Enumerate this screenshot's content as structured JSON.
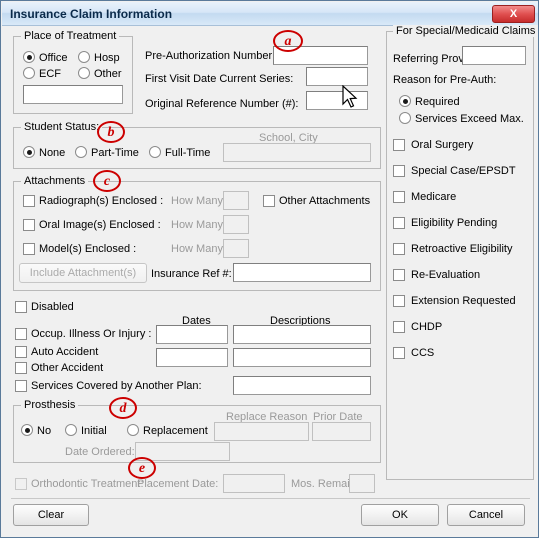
{
  "window": {
    "title": "Insurance Claim Information",
    "close_label": "X"
  },
  "place_of_treatment": {
    "legend": "Place of Treatment",
    "options": [
      {
        "label": "Office",
        "selected": true
      },
      {
        "label": "Hosp",
        "selected": false
      },
      {
        "label": "ECF",
        "selected": false
      },
      {
        "label": "Other",
        "selected": false
      }
    ],
    "other_value": ""
  },
  "preauth": {
    "number_label": "Pre-Authorization Number:",
    "number_value": "",
    "first_visit_label": "First Visit Date Current Series:",
    "first_visit_value": "",
    "orig_ref_label": "Original Reference Number (#):",
    "orig_ref_value": ""
  },
  "student_status": {
    "legend": "Student Status:",
    "options": [
      {
        "label": "None",
        "selected": true
      },
      {
        "label": "Part-Time",
        "selected": false
      },
      {
        "label": "Full-Time",
        "selected": false
      }
    ],
    "school_placeholder": "School, City",
    "school_value": ""
  },
  "attachments": {
    "legend": "Attachments",
    "rows": [
      {
        "label": "Radiograph(s) Enclosed :",
        "checked": false,
        "howmany_label": "How Many?",
        "howmany_value": ""
      },
      {
        "label": "Oral Image(s) Enclosed :",
        "checked": false,
        "howmany_label": "How Many?",
        "howmany_value": ""
      },
      {
        "label": "Model(s) Enclosed :",
        "checked": false,
        "howmany_label": "How Many?",
        "howmany_value": ""
      }
    ],
    "other_attachments": {
      "label": "Other Attachments",
      "checked": false
    },
    "include_button": "Include Attachment(s)",
    "insurance_ref_label": "Insurance Ref #:",
    "insurance_ref_value": ""
  },
  "conditions": {
    "disabled": {
      "label": "Disabled",
      "checked": false
    },
    "dates_header": "Dates",
    "descriptions_header": "Descriptions",
    "rows": [
      {
        "label": "Occup. Illness Or Injury :",
        "checked": false,
        "date": "",
        "desc": ""
      },
      {
        "label": "Auto Accident",
        "checked": false,
        "date": "",
        "desc": ""
      },
      {
        "label": "Other Accident",
        "checked": false,
        "date": "",
        "desc": ""
      },
      {
        "label": "Services Covered by Another Plan:",
        "checked": false,
        "date": "",
        "desc": ""
      }
    ]
  },
  "prosthesis": {
    "legend": "Prosthesis",
    "options": [
      {
        "label": "No",
        "selected": true
      },
      {
        "label": "Initial",
        "selected": false
      },
      {
        "label": "Replacement",
        "selected": false
      }
    ],
    "replace_reason_label": "Replace Reason",
    "replace_reason_value": "",
    "prior_date_label": "Prior Date",
    "prior_date_value": "",
    "date_ordered_label": "Date Ordered:",
    "date_ordered_value": ""
  },
  "orthodontic": {
    "label": "Orthodontic Treatment:",
    "checked": false,
    "placement_label": "Placement Date:",
    "placement_value": "",
    "mos_remain_label": "Mos. Remain:",
    "mos_remain_value": ""
  },
  "special_medicaid": {
    "legend": "For Special/Medicaid Claims",
    "referring_prov_label": "Referring Prov:",
    "referring_prov_value": "",
    "reason_label": "Reason for Pre-Auth:",
    "reason_options": [
      {
        "label": "Required",
        "selected": true
      },
      {
        "label": "Services Exceed Max.",
        "selected": false
      }
    ],
    "checkboxes": [
      {
        "label": "Oral Surgery",
        "checked": false
      },
      {
        "label": "Special Case/EPSDT",
        "checked": false
      },
      {
        "label": "Medicare",
        "checked": false
      },
      {
        "label": "Eligibility Pending",
        "checked": false
      },
      {
        "label": "Retroactive Eligibility",
        "checked": false
      },
      {
        "label": "Re-Evaluation",
        "checked": false
      },
      {
        "label": "Extension Requested",
        "checked": false
      },
      {
        "label": "CHDP",
        "checked": false
      },
      {
        "label": "CCS",
        "checked": false
      }
    ]
  },
  "footer": {
    "clear": "Clear",
    "ok": "OK",
    "cancel": "Cancel"
  },
  "annotations": [
    {
      "id": "a",
      "label": "a"
    },
    {
      "id": "b",
      "label": "b"
    },
    {
      "id": "c",
      "label": "c"
    },
    {
      "id": "d",
      "label": "d"
    },
    {
      "id": "e",
      "label": "e"
    }
  ],
  "colors": {
    "annotation": "#cc0000",
    "title_text": "#0a2a4a",
    "close_button": "#d14141"
  }
}
